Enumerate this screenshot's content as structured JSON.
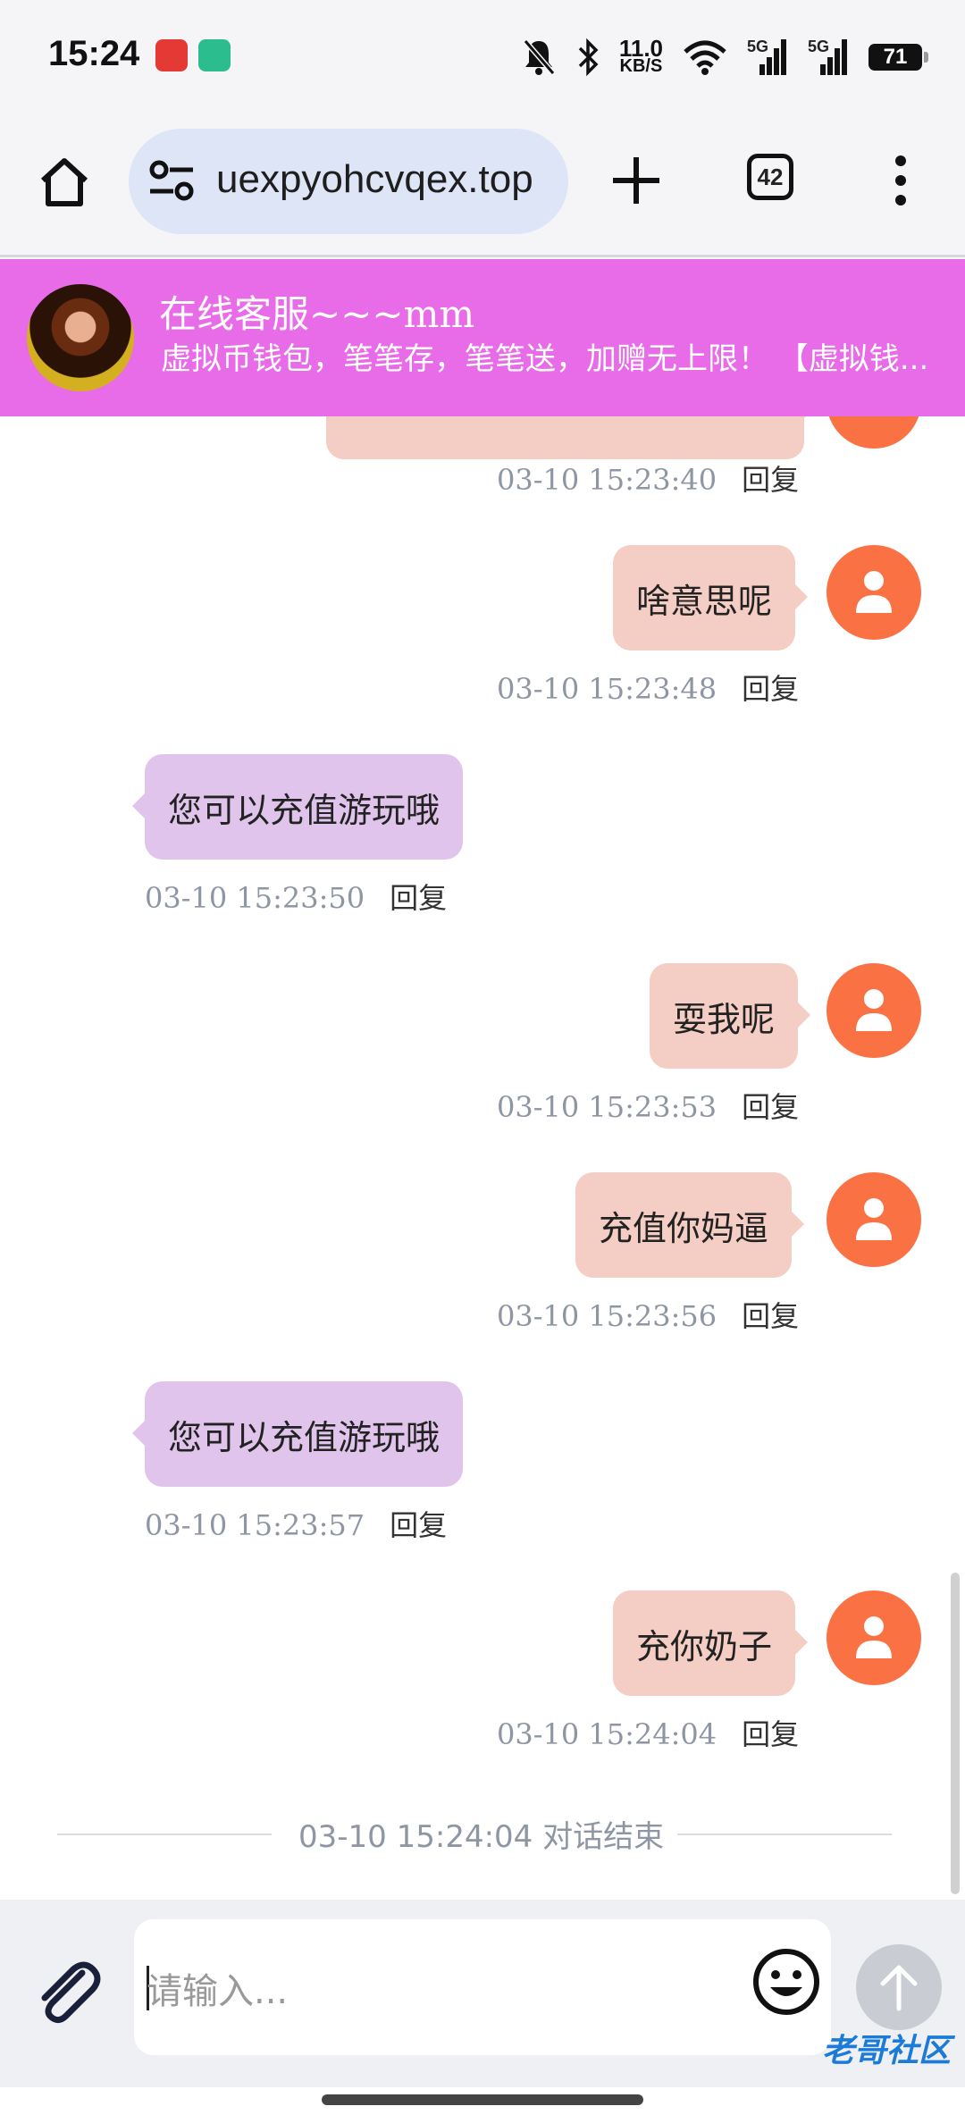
{
  "status_bar": {
    "time": "15:24",
    "net_speed_value": "11.0",
    "net_speed_unit": "KB/S",
    "signal_1": "5G",
    "signal_2": "5G",
    "battery": "71"
  },
  "browser": {
    "url": "uexpyohcvqex.top",
    "tab_count": "42"
  },
  "chat_header": {
    "agent_name": "在线客服~~~mm",
    "notice": "虚拟币钱包，笔笔存，笔笔送，加赠无上限！ 【虚拟钱..."
  },
  "messages": [
    {
      "type": "sent",
      "text": "",
      "time": "03-10 15:23:40",
      "reply": "回复"
    },
    {
      "type": "sent",
      "text": "啥意思呢",
      "time": "03-10 15:23:48",
      "reply": "回复"
    },
    {
      "type": "received",
      "text": "您可以充值游玩哦",
      "time": "03-10 15:23:50",
      "reply": "回复"
    },
    {
      "type": "sent",
      "text": "耍我呢",
      "time": "03-10 15:23:53",
      "reply": "回复"
    },
    {
      "type": "sent",
      "text": "充值你妈逼",
      "time": "03-10 15:23:56",
      "reply": "回复"
    },
    {
      "type": "received",
      "text": "您可以充值游玩哦",
      "time": "03-10 15:23:57",
      "reply": "回复"
    },
    {
      "type": "sent",
      "text": "充你奶子",
      "time": "03-10 15:24:04",
      "reply": "回复"
    }
  ],
  "end_notice": "03-10 15:24:04 对话结束",
  "input": {
    "placeholder": "请输入..."
  },
  "watermark": "老哥社区",
  "colors": {
    "header_bg": "#e86ce8",
    "sent_bubble": "#f4cdc4",
    "received_bubble": "#e0c4ec",
    "user_avatar": "#fa7244"
  }
}
